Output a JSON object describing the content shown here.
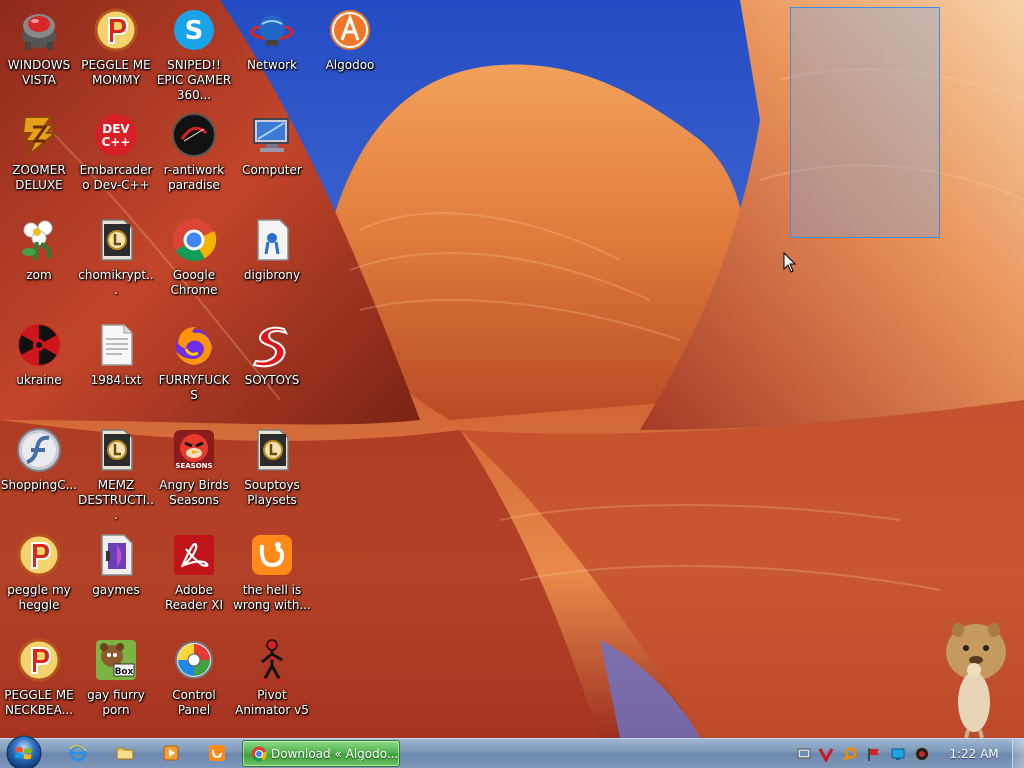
{
  "desktop": {
    "icons": [
      {
        "label": "WINDOWS VISTA",
        "icon": "robot-app-icon"
      },
      {
        "label": "PEGGLE ME MOMMY",
        "icon": "peggle-icon"
      },
      {
        "label": "SNIPED!! EPIC GAMER 360...",
        "icon": "skype-icon"
      },
      {
        "label": "Network",
        "icon": "network-icon"
      },
      {
        "label": "Algodoo",
        "icon": "algodoo-icon"
      },
      {
        "label": "ZOOMER DELUXE",
        "icon": "zuma-icon"
      },
      {
        "label": "Embarcadero Dev-C++",
        "icon": "devcpp-icon"
      },
      {
        "label": "r-antiwork paradise",
        "icon": "black-circle-app-icon"
      },
      {
        "label": "Computer",
        "icon": "computer-icon"
      },
      {
        "label": "zom",
        "icon": "flower-icon"
      },
      {
        "label": "chomikrypt...",
        "icon": "shortcut-file-icon"
      },
      {
        "label": "Google Chrome",
        "icon": "chrome-icon"
      },
      {
        "label": "digibrony",
        "icon": "document-app-icon"
      },
      {
        "label": "ukraine",
        "icon": "radiation-icon"
      },
      {
        "label": "1984.txt",
        "icon": "text-file-icon"
      },
      {
        "label": "FURRYFUCKS",
        "icon": "firefox-icon"
      },
      {
        "label": "SOYTOYS",
        "icon": "red-s-icon"
      },
      {
        "label": "ShoppingC...",
        "icon": "flash-icon"
      },
      {
        "label": "MEMZ DESTRUCTI...",
        "icon": "shortcut-file-icon"
      },
      {
        "label": "Angry Birds Seasons",
        "icon": "angry-birds-icon"
      },
      {
        "label": "Souptoys Playsets",
        "icon": "shortcut-file-icon"
      },
      {
        "label": "peggle my heggle",
        "icon": "peggle-icon"
      },
      {
        "label": "gaymes",
        "icon": "games-folder-icon"
      },
      {
        "label": "Adobe Reader XI",
        "icon": "adobe-reader-icon"
      },
      {
        "label": "the hell is wrong with...",
        "icon": "uc-browser-icon"
      },
      {
        "label": "PEGGLE ME NECKBEA...",
        "icon": "peggle-icon"
      },
      {
        "label": "gay fiurry porn",
        "icon": "box-bear-icon"
      },
      {
        "label": "Control Panel",
        "icon": "control-panel-icon"
      },
      {
        "label": "Pivot Animator v5",
        "icon": "stick-figure-icon"
      }
    ]
  },
  "taskbar": {
    "start_icon": "windows-start-orb-icon",
    "quick_launch": [
      {
        "name": "internet-explorer",
        "icon": "internet-explorer-icon"
      },
      {
        "name": "explorer",
        "icon": "folder-icon"
      },
      {
        "name": "media-player",
        "icon": "media-player-icon"
      },
      {
        "name": "uc-browser",
        "icon": "uc-browser-icon"
      }
    ],
    "active_task": {
      "label": "Download « Algodo...",
      "icon": "chrome-icon"
    },
    "tray_icons": [
      "network-tray-icon",
      "antivirus-tray-icon",
      "search-tray-icon",
      "flag-tray-icon",
      "display-tray-icon",
      "volume-tray-icon"
    ],
    "clock": "1:22 AM"
  },
  "colors": {
    "taskbar": "#7b96b8",
    "active_task": "#4fb34b",
    "selection": "#3d8ee6",
    "sky": "#2f56c8"
  }
}
